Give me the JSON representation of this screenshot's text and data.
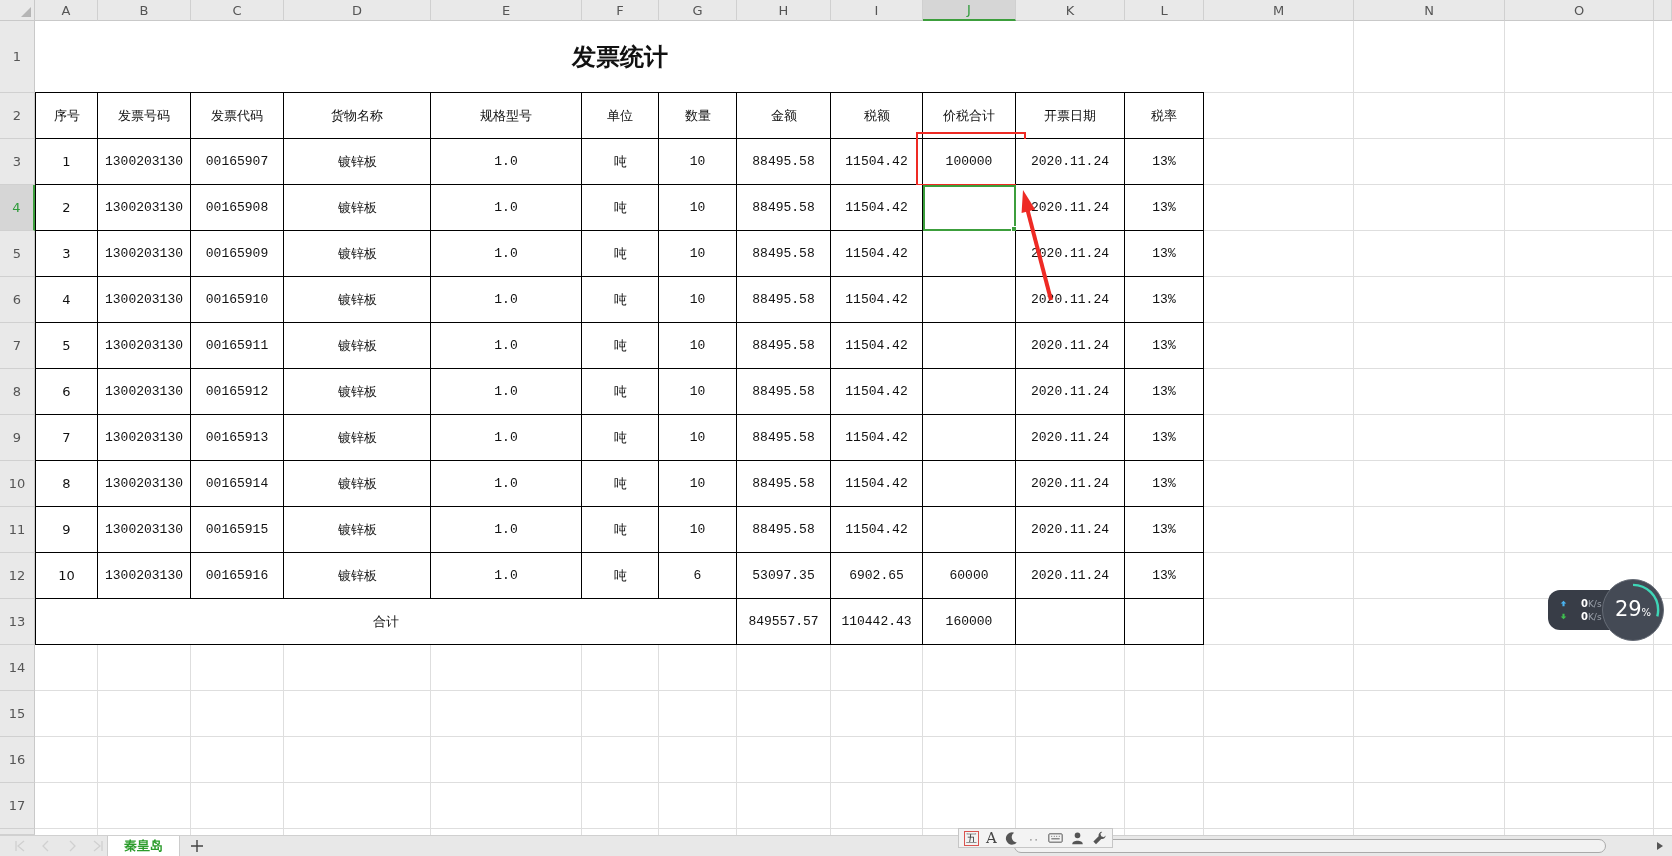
{
  "column_headers": [
    {
      "label": "A",
      "selected": false
    },
    {
      "label": "B",
      "selected": false
    },
    {
      "label": "C",
      "selected": false
    },
    {
      "label": "D",
      "selected": false
    },
    {
      "label": "E",
      "selected": false
    },
    {
      "label": "F",
      "selected": false
    },
    {
      "label": "G",
      "selected": false
    },
    {
      "label": "H",
      "selected": false
    },
    {
      "label": "I",
      "selected": false
    },
    {
      "label": "J",
      "selected": true
    },
    {
      "label": "K",
      "selected": false
    },
    {
      "label": "L",
      "selected": false
    },
    {
      "label": "M",
      "selected": false
    },
    {
      "label": "N",
      "selected": false
    },
    {
      "label": "O",
      "selected": false
    }
  ],
  "row_headers": [
    {
      "label": "1",
      "selected": false
    },
    {
      "label": "2",
      "selected": false
    },
    {
      "label": "3",
      "selected": false
    },
    {
      "label": "4",
      "selected": true
    },
    {
      "label": "5",
      "selected": false
    },
    {
      "label": "6",
      "selected": false
    },
    {
      "label": "7",
      "selected": false
    },
    {
      "label": "8",
      "selected": false
    },
    {
      "label": "9",
      "selected": false
    },
    {
      "label": "10",
      "selected": false
    },
    {
      "label": "11",
      "selected": false
    },
    {
      "label": "12",
      "selected": false
    },
    {
      "label": "13",
      "selected": false
    },
    {
      "label": "14",
      "selected": false
    },
    {
      "label": "15",
      "selected": false
    },
    {
      "label": "16",
      "selected": false
    },
    {
      "label": "17",
      "selected": false
    }
  ],
  "title": "发票统计",
  "table_header": [
    "序号",
    "发票号码",
    "发票代码",
    "货物名称",
    "规格型号",
    "单位",
    "数量",
    "金额",
    "税额",
    "价税合计",
    "开票日期",
    "税率"
  ],
  "data_rows": [
    {
      "no": "1",
      "invoice_number": "1300203130",
      "invoice_code": "00165907",
      "goods": "镀锌板",
      "spec": "1.0",
      "unit": "吨",
      "quantity": "10",
      "amount": "88495.58",
      "tax": "11504.42",
      "total": "100000",
      "date": "2020.11.24",
      "rate": "13%",
      "selected": false,
      "highlighted": true
    },
    {
      "no": "2",
      "invoice_number": "1300203130",
      "invoice_code": "00165908",
      "goods": "镀锌板",
      "spec": "1.0",
      "unit": "吨",
      "quantity": "10",
      "amount": "88495.58",
      "tax": "11504.42",
      "date": "2020.11.24",
      "rate": "13%",
      "selected": true,
      "highlighted": false
    },
    {
      "no": "3",
      "invoice_number": "1300203130",
      "invoice_code": "00165909",
      "goods": "镀锌板",
      "spec": "1.0",
      "unit": "吨",
      "quantity": "10",
      "amount": "88495.58",
      "tax": "11504.42",
      "date": "2020.11.24",
      "rate": "13%",
      "selected": false,
      "highlighted": false
    },
    {
      "no": "4",
      "invoice_number": "1300203130",
      "invoice_code": "00165910",
      "goods": "镀锌板",
      "spec": "1.0",
      "unit": "吨",
      "quantity": "10",
      "amount": "88495.58",
      "tax": "11504.42",
      "date": "2020.11.24",
      "rate": "13%",
      "selected": false,
      "highlighted": false
    },
    {
      "no": "5",
      "invoice_number": "1300203130",
      "invoice_code": "00165911",
      "goods": "镀锌板",
      "spec": "1.0",
      "unit": "吨",
      "quantity": "10",
      "amount": "88495.58",
      "tax": "11504.42",
      "date": "2020.11.24",
      "rate": "13%",
      "selected": false,
      "highlighted": false
    },
    {
      "no": "6",
      "invoice_number": "1300203130",
      "invoice_code": "00165912",
      "goods": "镀锌板",
      "spec": "1.0",
      "unit": "吨",
      "quantity": "10",
      "amount": "88495.58",
      "tax": "11504.42",
      "date": "2020.11.24",
      "rate": "13%",
      "selected": false,
      "highlighted": false
    },
    {
      "no": "7",
      "invoice_number": "1300203130",
      "invoice_code": "00165913",
      "goods": "镀锌板",
      "spec": "1.0",
      "unit": "吨",
      "quantity": "10",
      "amount": "88495.58",
      "tax": "11504.42",
      "date": "2020.11.24",
      "rate": "13%",
      "selected": false,
      "highlighted": false
    },
    {
      "no": "8",
      "invoice_number": "1300203130",
      "invoice_code": "00165914",
      "goods": "镀锌板",
      "spec": "1.0",
      "unit": "吨",
      "quantity": "10",
      "amount": "88495.58",
      "tax": "11504.42",
      "date": "2020.11.24",
      "rate": "13%",
      "selected": false,
      "highlighted": false
    },
    {
      "no": "9",
      "invoice_number": "1300203130",
      "invoice_code": "00165915",
      "goods": "镀锌板",
      "spec": "1.0",
      "unit": "吨",
      "quantity": "10",
      "amount": "88495.58",
      "tax": "11504.42",
      "date": "2020.11.24",
      "rate": "13%",
      "selected": false,
      "highlighted": false
    },
    {
      "no": "10",
      "invoice_number": "1300203130",
      "invoice_code": "00165916",
      "goods": "镀锌板",
      "spec": "1.0",
      "unit": "吨",
      "quantity": "6",
      "amount": "53097.35",
      "tax": "6902.65",
      "total": "60000",
      "date": "2020.11.24",
      "rate": "13%",
      "selected": false,
      "highlighted": false
    }
  ],
  "total_row": {
    "label": "合计",
    "amount": "849557.57",
    "tax": "110442.43",
    "total": "160000"
  },
  "sheet_tabs": [
    {
      "label": "秦皇岛",
      "selected": true
    }
  ],
  "ime_toolbar": {
    "mode_glyph": "五",
    "font_glyph": "A"
  },
  "network_widget": {
    "upload": "0",
    "upload_unit": "K/s",
    "download": "0",
    "download_unit": "K/s",
    "load": "29",
    "load_unit": "%",
    "level": 0.29
  }
}
